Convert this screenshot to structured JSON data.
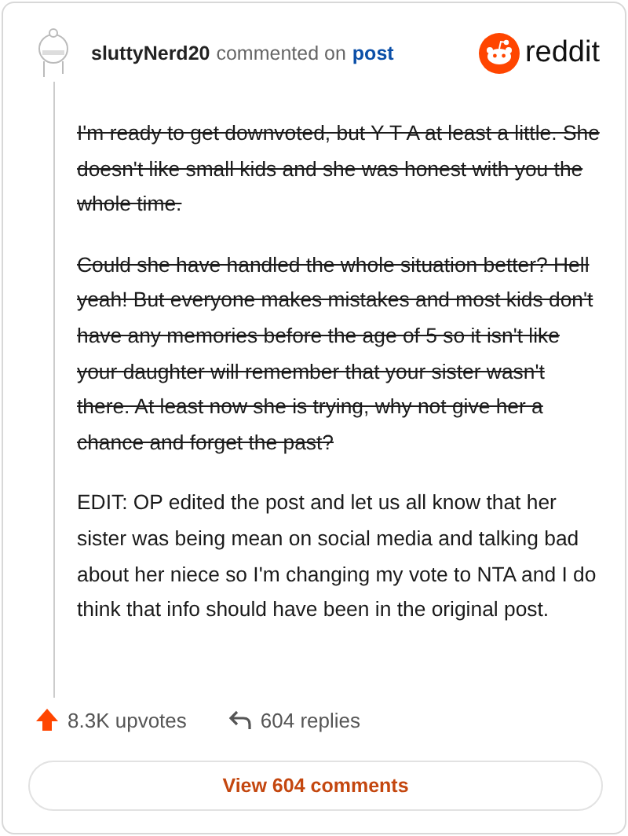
{
  "header": {
    "username": "sluttyNerd20",
    "action": "commented on",
    "link": "post",
    "brand": "reddit"
  },
  "paragraphs": [
    {
      "text": "I'm ready to get downvoted, but Y T A at least a little. She doesn't like small kids and she was honest with you the whole time.",
      "struck": true
    },
    {
      "text": "Could she have handled the whole situation better? Hell yeah! But everyone makes mistakes and most kids don't have any memories before the age of 5 so it isn't like your daughter will remember that your sister wasn't there. At least now she is trying, why not give her a chance and forget the past?",
      "struck": true
    },
    {
      "text": "EDIT: OP edited the post and let us all know that her sister was being mean on social media and talking bad about her niece so I'm changing my vote to NTA and I do think that info should have been in the original post.",
      "struck": false
    }
  ],
  "stats": {
    "upvotes": "8.3K upvotes",
    "replies": "604 replies"
  },
  "button": "View 604 comments"
}
